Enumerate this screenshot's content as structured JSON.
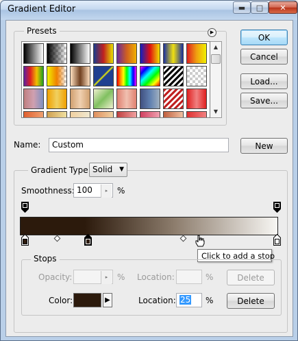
{
  "window": {
    "title": "Gradient Editor",
    "min_glyph": "▬",
    "max_glyph": "□",
    "close_glyph": "✕"
  },
  "presets": {
    "label": "Presets",
    "menu_icon": "flyout-menu-icon",
    "swatches": [
      "linear-gradient(90deg,#000,#fff)",
      "linear-gradient(90deg,#000,rgba(0,0,0,0)),repeating-conic-gradient(#ccc 0 25%,#fff 0 50%) 0 0/8px 8px",
      "linear-gradient(90deg,#000,#fff)",
      "linear-gradient(90deg,#1a3c8c,#c02020,#e8e000)",
      "linear-gradient(90deg,#6a2a9a,#d06020,#f0b000)",
      "linear-gradient(90deg,#1020c0,#e01010,#f0e000)",
      "linear-gradient(90deg,#1a30a0,#f0e010,#1a30a0)",
      "linear-gradient(90deg,#e02020,#f0a010,#f0f000)",
      "linear-gradient(90deg,#6020a0,#e02020,#f0c000,#20a020)",
      "linear-gradient(90deg,#f0f000,#f08000,rgba(255,128,0,0)),repeating-conic-gradient(#ccc 0 25%,#fff 0 50%) 0 0/8px 8px",
      "linear-gradient(90deg,#ffe0c0,#704020,#ffe0c0)",
      "linear-gradient(135deg,#204090 45%,#f0f000 50%,#204090 55%)",
      "linear-gradient(90deg,#f00,#f80,#ff0,#0f0,#0ff,#00f,#f0f)",
      "linear-gradient(135deg,#f0f 0%,#00f 20%,#0ff 40%,#0f0 60%,#ff0 80%,#f00 100%)",
      "repeating-linear-gradient(135deg,#000 0 3px,#fff 3px 6px)",
      "linear-gradient(90deg,rgba(255,255,255,0),rgba(255,255,255,0)),repeating-conic-gradient(#ccc 0 25%,#fff 0 50%) 0 0/8px 8px",
      "linear-gradient(90deg,#c08080,#d0a0b0,#8090c0)",
      "linear-gradient(90deg,#f0a000,#f0d060,#f0a000)",
      "linear-gradient(90deg,#d0a070,#f0d0b0,#d0a070)",
      "linear-gradient(135deg,#f0f0d0,#80c060,#f0f0d0)",
      "linear-gradient(90deg,#e08070,#f0c0b0,#e08070)",
      "linear-gradient(90deg,#405080,#6080b0,#a0b0c0)",
      "repeating-linear-gradient(135deg,#c02020 0 3px,#fff 3px 6px)",
      "linear-gradient(90deg,#e02020,#f08080,#e02020)",
      "linear-gradient(90deg,#e06030,#f0a070)",
      "linear-gradient(90deg,#d0a050,#f0e0a0)",
      "linear-gradient(90deg,#f0d0a0,#f0e8d0)",
      "linear-gradient(90deg,#e09060,#f0d0a0)",
      "linear-gradient(90deg,#c04040,#f0a0a0)",
      "linear-gradient(90deg,#d04060,#f0a0b0)",
      "linear-gradient(90deg,#c06040,#f0c0a0)",
      "linear-gradient(90deg,#e03030,#f08080)"
    ]
  },
  "buttons": {
    "ok": "OK",
    "cancel": "Cancel",
    "load": "Load...",
    "save": "Save...",
    "new": "New"
  },
  "name": {
    "label": "Name:",
    "value": "Custom"
  },
  "gradient": {
    "type_label": "Gradient Type:",
    "type_value": "Solid",
    "smoothness_label": "Smoothness:",
    "smoothness_value": "100",
    "smoothness_unit": "%",
    "colors": [
      "#2c1a0c",
      "#8d7d6d",
      "#f7f6f3"
    ],
    "tooltip": "Click to add a stop"
  },
  "stops": {
    "label": "Stops",
    "opacity_label": "Opacity:",
    "opacity_value": "",
    "opacity_unit": "%",
    "opacity_location_label": "Location:",
    "opacity_location_value": "",
    "opacity_location_unit": "%",
    "opacity_delete": "Delete",
    "color_label": "Color:",
    "color_value": "#2c1a0c",
    "color_location_label": "Location:",
    "color_location_value": "25",
    "color_location_unit": "%",
    "color_delete": "Delete"
  }
}
